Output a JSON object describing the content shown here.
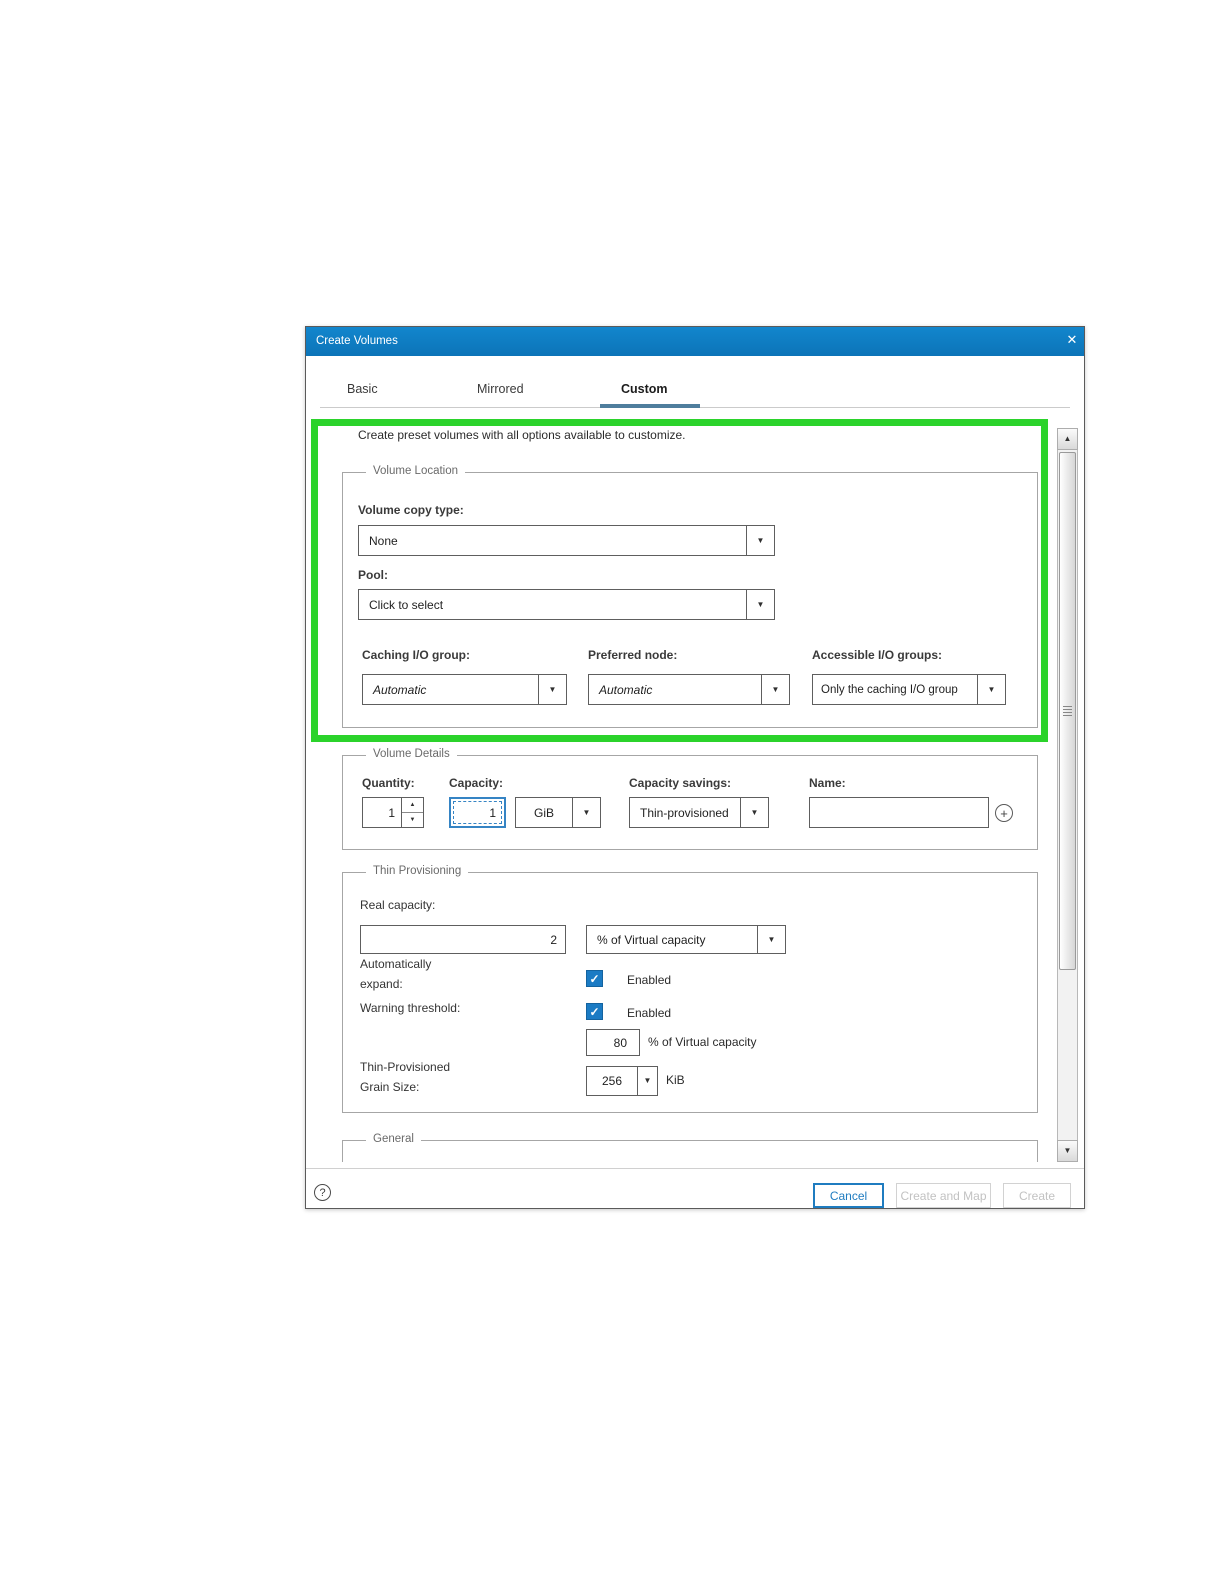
{
  "window": {
    "title": "Create Volumes"
  },
  "icons": {
    "close": "✕",
    "dropdown": "▼",
    "spinner_up": "▲",
    "spinner_down": "▼",
    "scroll_up": "▲",
    "scroll_down": "▼",
    "check": "✓",
    "plus": "+",
    "help": "?"
  },
  "tabs": {
    "basic": "Basic",
    "mirrored": "Mirrored",
    "custom": "Custom"
  },
  "intro": "Create preset volumes with all options available to customize.",
  "volume_location": {
    "legend": "Volume Location",
    "volume_copy_type_label": "Volume copy type:",
    "volume_copy_type_value": "None",
    "pool_label": "Pool:",
    "pool_value": "Click to select",
    "caching_io_group_label": "Caching I/O group:",
    "caching_io_group_value": "Automatic",
    "preferred_node_label": "Preferred node:",
    "preferred_node_value": "Automatic",
    "accessible_io_groups_label": "Accessible I/O groups:",
    "accessible_io_groups_value": "Only the caching I/O group"
  },
  "volume_details": {
    "legend": "Volume Details",
    "quantity_label": "Quantity:",
    "quantity_value": "1",
    "capacity_label": "Capacity:",
    "capacity_value": "1",
    "capacity_unit": "GiB",
    "capacity_savings_label": "Capacity savings:",
    "capacity_savings_value": "Thin-provisioned",
    "name_label": "Name:",
    "name_value": ""
  },
  "thin_provisioning": {
    "legend": "Thin Provisioning",
    "real_capacity_label": "Real capacity:",
    "real_capacity_value": "2",
    "real_capacity_unit": "% of Virtual capacity",
    "auto_expand_label_line1": "Automatically",
    "auto_expand_label_line2": "expand:",
    "auto_expand_value": "Enabled",
    "warning_threshold_label": "Warning threshold:",
    "warning_threshold_value": "Enabled",
    "warning_threshold_percent": "80",
    "warning_threshold_unit": "% of Virtual capacity",
    "grain_size_label_line1": "Thin-Provisioned",
    "grain_size_label_line2": "Grain Size:",
    "grain_size_value": "256",
    "grain_size_unit": "KiB"
  },
  "general": {
    "legend": "General"
  },
  "footer": {
    "cancel": "Cancel",
    "create_and_map": "Create and Map",
    "create": "Create"
  },
  "colors": {
    "title_bar_blue": "#0e7abf",
    "highlight_green": "#2bd32b",
    "checkbox_blue": "#1b7bc4",
    "tab_underline": "#4f7e9d",
    "cancel_blue": "#1f7cc0"
  }
}
